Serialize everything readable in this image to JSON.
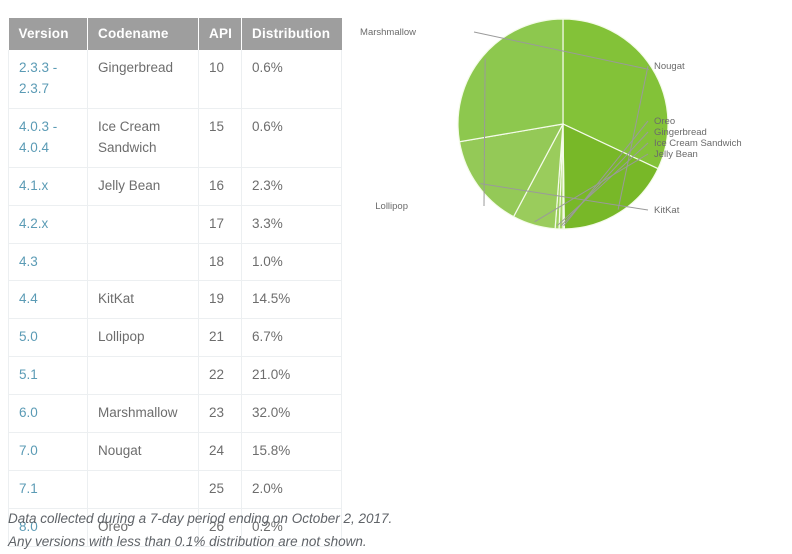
{
  "table": {
    "columns": [
      "Version",
      "Codename",
      "API",
      "Distribution"
    ],
    "rows": [
      {
        "version": "2.3.3 - 2.3.7",
        "codename": "Gingerbread",
        "api": "10",
        "distribution": "0.6%"
      },
      {
        "version": "4.0.3 - 4.0.4",
        "codename": "Ice Cream Sandwich",
        "api": "15",
        "distribution": "0.6%"
      },
      {
        "version": "4.1.x",
        "codename": "Jelly Bean",
        "api": "16",
        "distribution": "2.3%"
      },
      {
        "version": "4.2.x",
        "codename": "",
        "api": "17",
        "distribution": "3.3%"
      },
      {
        "version": "4.3",
        "codename": "",
        "api": "18",
        "distribution": "1.0%"
      },
      {
        "version": "4.4",
        "codename": "KitKat",
        "api": "19",
        "distribution": "14.5%"
      },
      {
        "version": "5.0",
        "codename": "Lollipop",
        "api": "21",
        "distribution": "6.7%"
      },
      {
        "version": "5.1",
        "codename": "",
        "api": "22",
        "distribution": "21.0%"
      },
      {
        "version": "6.0",
        "codename": "Marshmallow",
        "api": "23",
        "distribution": "32.0%"
      },
      {
        "version": "7.0",
        "codename": "Nougat",
        "api": "24",
        "distribution": "15.8%"
      },
      {
        "version": "7.1",
        "codename": "",
        "api": "25",
        "distribution": "2.0%"
      },
      {
        "version": "8.0",
        "codename": "Oreo",
        "api": "26",
        "distribution": "0.2%"
      }
    ]
  },
  "footnotes": {
    "line1": "Data collected during a 7-day period ending on October 2, 2017.",
    "line2": "Any versions with less than 0.1% distribution are not shown."
  },
  "chart_data": {
    "type": "pie",
    "title": "",
    "legend_position": "outside-callout-labels",
    "labels": [
      "Marshmallow",
      "Nougat",
      "Oreo",
      "Gingerbread",
      "Ice Cream Sandwich",
      "Jelly Bean",
      "KitKat",
      "Lollipop"
    ],
    "values": [
      32.0,
      17.8,
      0.2,
      0.6,
      0.6,
      6.6,
      14.5,
      27.7
    ],
    "value_unit": "%",
    "colors": [
      "#83c238",
      "#78b828",
      "#a8d66e",
      "#a2d264",
      "#9ed05f",
      "#9acc5c",
      "#94c957",
      "#8dc84e"
    ],
    "slices": [
      {
        "label": "Marshmallow",
        "value": 32.0,
        "color": "#83c238"
      },
      {
        "label": "Nougat",
        "value": 17.8,
        "color": "#78b828"
      },
      {
        "label": "Oreo",
        "value": 0.2,
        "color": "#a8d66e"
      },
      {
        "label": "Gingerbread",
        "value": 0.6,
        "color": "#a2d264"
      },
      {
        "label": "Ice Cream Sandwich",
        "value": 0.6,
        "color": "#9ed05f"
      },
      {
        "label": "Jelly Bean",
        "value": 6.6,
        "color": "#9acc5c"
      },
      {
        "label": "KitKat",
        "value": 14.5,
        "color": "#94c957"
      },
      {
        "label": "Lollipop",
        "value": 27.7,
        "color": "#8dc84e"
      }
    ]
  }
}
